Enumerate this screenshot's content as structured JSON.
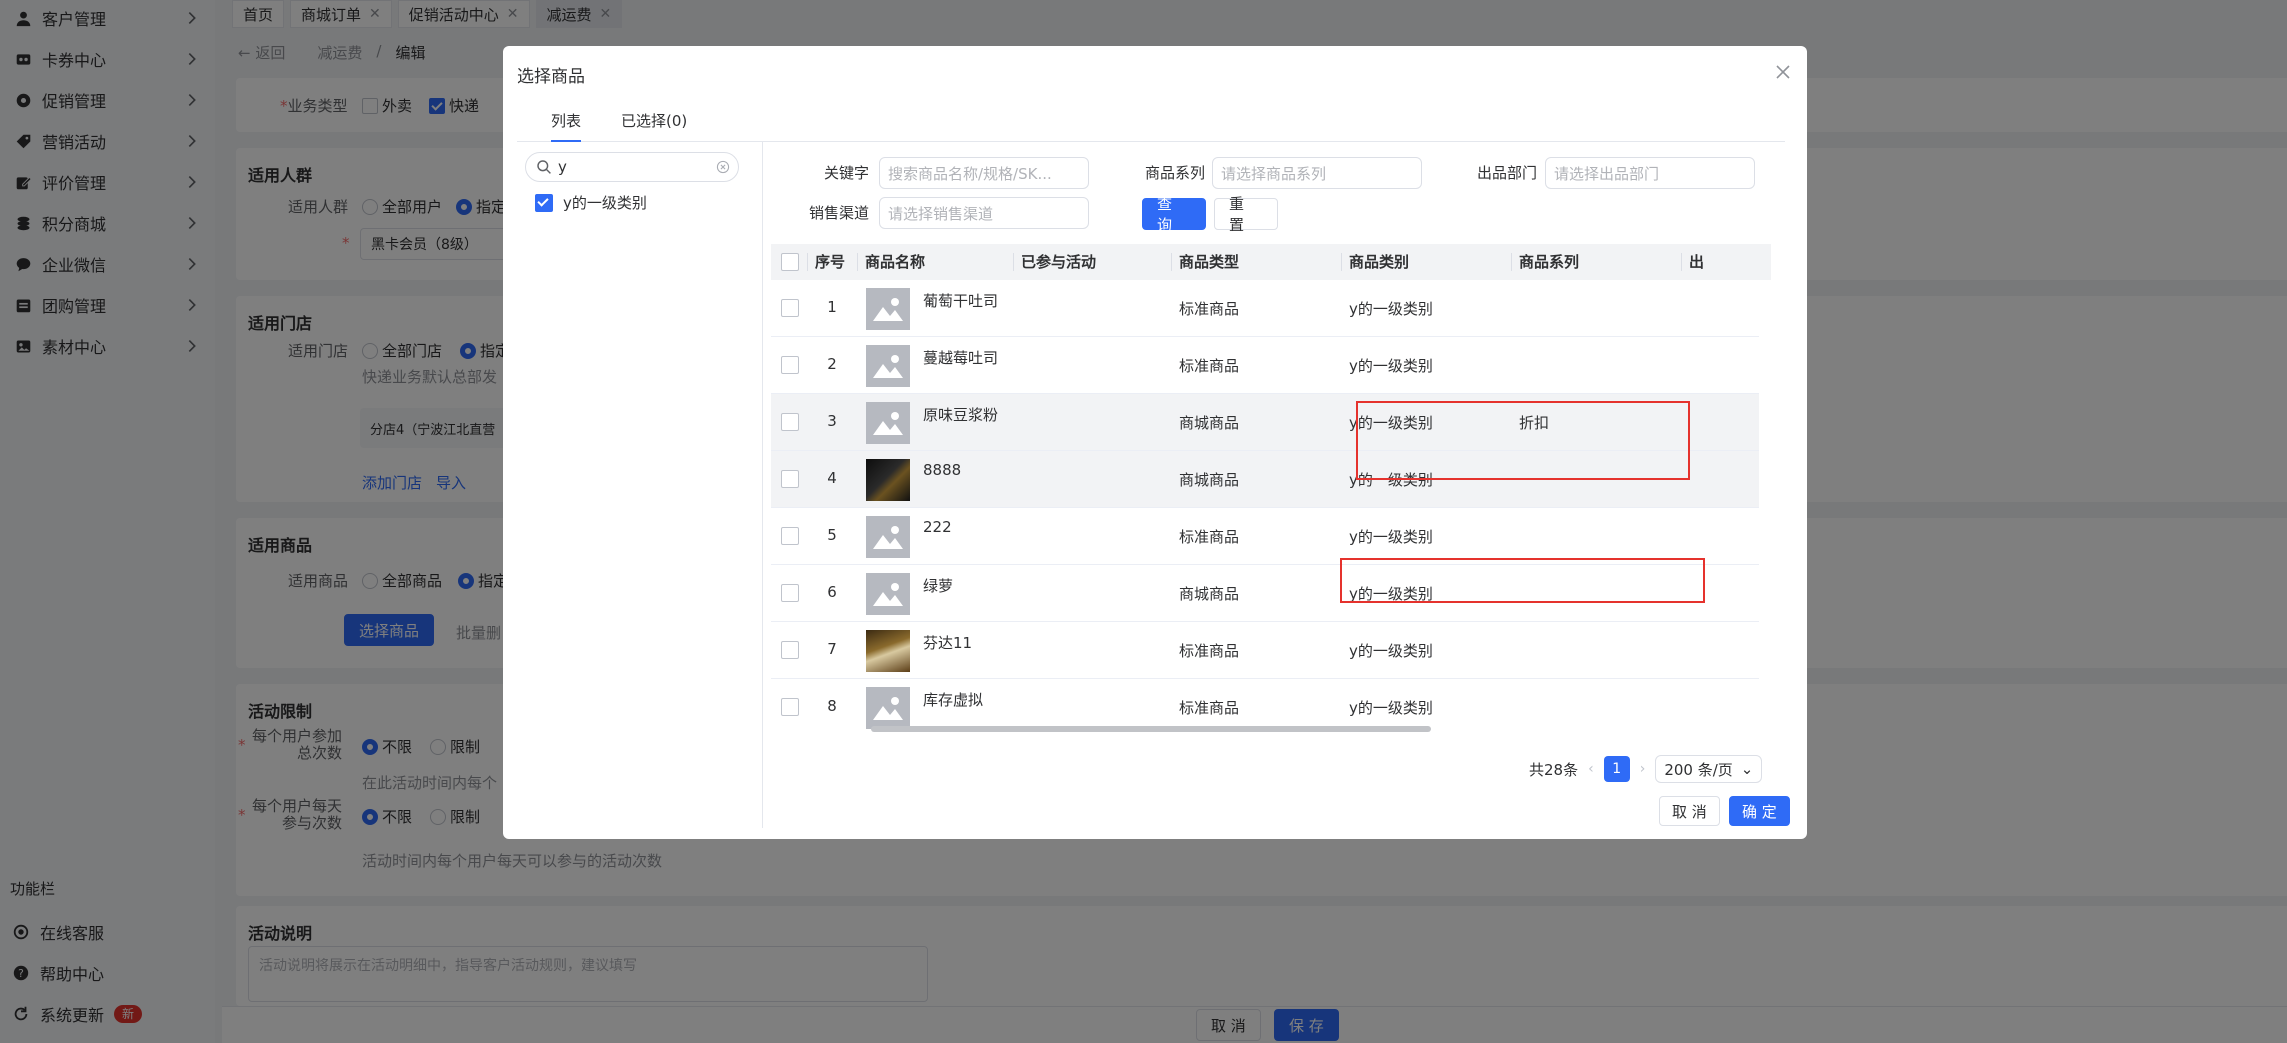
{
  "sidebar": {
    "items": [
      {
        "label": "客户管理",
        "icon": "user-icon"
      },
      {
        "label": "卡券中心",
        "icon": "ticket-icon"
      },
      {
        "label": "促销管理",
        "icon": "gear-icon"
      },
      {
        "label": "营销活动",
        "icon": "tag-icon"
      },
      {
        "label": "评价管理",
        "icon": "edit-icon"
      },
      {
        "label": "积分商城",
        "icon": "coins-icon"
      },
      {
        "label": "企业微信",
        "icon": "chat-icon"
      },
      {
        "label": "团购管理",
        "icon": "group-icon"
      },
      {
        "label": "素材中心",
        "icon": "image-icon"
      }
    ],
    "section_title": "功能栏",
    "footer": [
      {
        "label": "在线客服",
        "icon": "service-icon"
      },
      {
        "label": "帮助中心",
        "icon": "help-icon"
      },
      {
        "label": "系统更新",
        "icon": "refresh-icon",
        "badge": "新"
      }
    ]
  },
  "tabs": [
    {
      "label": "首页",
      "closable": false
    },
    {
      "label": "商城订单",
      "closable": true
    },
    {
      "label": "促销活动中心",
      "closable": true
    },
    {
      "label": "减运费",
      "closable": true,
      "active": true
    }
  ],
  "breadcrumb": {
    "back": "返回",
    "parent": "减运费",
    "sep": "/",
    "current": "编辑"
  },
  "form": {
    "business_type": {
      "label": "业务类型",
      "opt1": "外卖",
      "opt2": "快递"
    },
    "audience": {
      "title": "适用人群",
      "label": "适用人群",
      "all": "全部用户",
      "specified": "指定",
      "select_value": "黑卡会员（8级）"
    },
    "stores": {
      "title": "适用门店",
      "label": "适用门店",
      "all": "全部门店",
      "specified": "指定",
      "hint": "快递业务默认总部发",
      "store_tag": "分店4（宁波江北直营",
      "add_store": "添加门店",
      "import": "导入"
    },
    "goods": {
      "title": "适用商品",
      "label": "适用商品",
      "all": "全部商品",
      "specified": "指定",
      "select_btn": "选择商品",
      "batch": "批量删"
    },
    "limit": {
      "title": "活动限制",
      "total_label_1": "每个用户参加",
      "total_label_2": "总次数",
      "unlimited": "不限",
      "limited": "限制",
      "total_hint": "在此活动时间内每个",
      "daily_label_1": "每个用户每天",
      "daily_label_2": "参与次数",
      "daily_hint": "活动时间内每个用户每天可以参与的活动次数"
    },
    "desc": {
      "title": "活动说明",
      "placeholder": "活动说明将展示在活动明细中，指导客户活动规则，建议填写"
    }
  },
  "footer_buttons": {
    "cancel": "取 消",
    "save": "保 存"
  },
  "dialog": {
    "title": "选择商品",
    "tabs": [
      "列表",
      "已选择(0)"
    ],
    "tree": {
      "search_value": "y",
      "node": "y的一级类别"
    },
    "filters": {
      "keyword_label": "关键字",
      "keyword_placeholder": "搜索商品名称/规格/SK...",
      "series_label": "商品系列",
      "series_placeholder": "请选择商品系列",
      "dept_label": "出品部门",
      "dept_placeholder": "请选择出品部门",
      "channel_label": "销售渠道",
      "channel_placeholder": "请选择销售渠道",
      "query_btn": "查 询",
      "reset_btn": "重 置"
    },
    "columns": [
      "序号",
      "商品名称",
      "已参与活动",
      "商品类型",
      "商品类别",
      "商品系列",
      "出"
    ],
    "rows": [
      {
        "no": "1",
        "name": "葡萄干吐司",
        "activity": "",
        "type": "标准商品",
        "category": "y的一级类别",
        "series": "",
        "thumb": "placeholder"
      },
      {
        "no": "2",
        "name": "蔓越莓吐司",
        "activity": "",
        "type": "标准商品",
        "category": "y的一级类别",
        "series": "",
        "thumb": "placeholder"
      },
      {
        "no": "3",
        "name": "原味豆浆粉",
        "activity": "",
        "type": "商城商品",
        "category": "y的一级类别",
        "series": "折扣",
        "thumb": "placeholder"
      },
      {
        "no": "4",
        "name": "8888",
        "activity": "",
        "type": "商城商品",
        "category": "y的一级类别",
        "series": "",
        "thumb": "photo-dark"
      },
      {
        "no": "5",
        "name": "222",
        "activity": "",
        "type": "标准商品",
        "category": "y的一级类别",
        "series": "",
        "thumb": "placeholder"
      },
      {
        "no": "6",
        "name": "绿萝",
        "activity": "",
        "type": "商城商品",
        "category": "y的一级类别",
        "series": "",
        "thumb": "placeholder"
      },
      {
        "no": "7",
        "name": "芬达11",
        "activity": "",
        "type": "标准商品",
        "category": "y的一级类别",
        "series": "",
        "thumb": "photo-bottle"
      },
      {
        "no": "8",
        "name": "库存虚拟",
        "activity": "",
        "type": "标准商品",
        "category": "y的一级类别",
        "series": "",
        "thumb": "placeholder"
      }
    ],
    "pager": {
      "total": "共28条",
      "page": "1",
      "size": "200 条/页"
    },
    "buttons": {
      "cancel": "取 消",
      "confirm": "确 定"
    },
    "annotation_color": "#e5322d"
  }
}
